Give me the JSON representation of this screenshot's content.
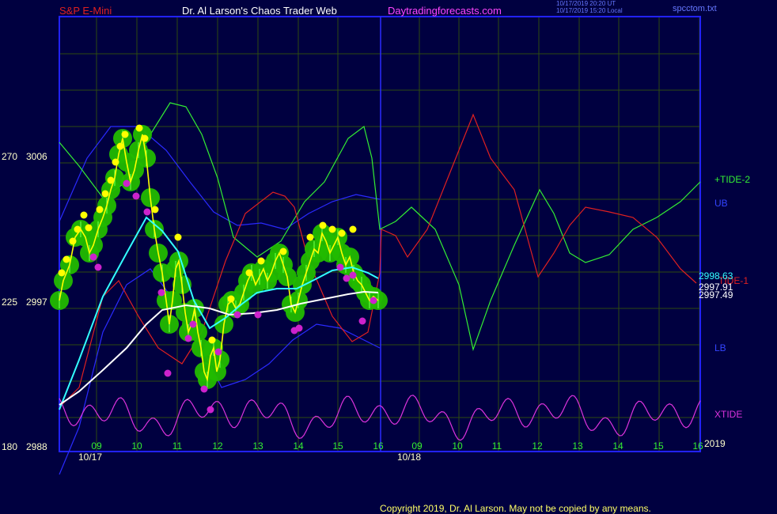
{
  "header": {
    "instrument": "S&P E-Mini",
    "title": "Dr. Al Larson's Chaos Trader Web",
    "website": "Daytradingforecasts.com",
    "time_ut": "10/17/2019 20:20 UT",
    "time_local": "10/17/2019 15:20 Local",
    "file": "spcctom.txt"
  },
  "colors": {
    "background": "#000040",
    "frame": "#2222ff",
    "grid": "#2e4a10",
    "price": "#ffff00",
    "ma_fast": "#33ffff",
    "ma_slow": "#ffffff",
    "tide1": "#e02020",
    "tide2": "#33ee33",
    "bands": "#2a2aff",
    "xtide": "#dd33dd",
    "highs": "#ffff00",
    "lows": "#cc22cc",
    "glow": "#22cc00"
  },
  "y_axis": {
    "labels": [
      {
        "left": "270",
        "right": "3006",
        "value": 3006
      },
      {
        "left": "225",
        "right": "2997",
        "value": 2997
      },
      {
        "left": "180",
        "right": "2988",
        "value": 2988
      }
    ]
  },
  "x_axis": {
    "hour_labels": [
      "09",
      "10",
      "11",
      "12",
      "13",
      "14",
      "15",
      "16",
      "09",
      "10",
      "11",
      "12",
      "13",
      "14",
      "15",
      "16"
    ],
    "date_labels": [
      "10/17",
      "10/18"
    ],
    "year": "2019"
  },
  "right_labels": {
    "tide2": "+TIDE-2",
    "ub": "UB",
    "lb": "LB",
    "xtide": "XTIDE",
    "tide1": "TIDE-1",
    "values": [
      "2998.63",
      "2997.91",
      "2997.49"
    ]
  },
  "footer": {
    "copyright": "Copyright 2019, Dr. Al Larson. May not be copied by any means."
  },
  "chart_data": {
    "type": "line",
    "title": "S&P E-Mini",
    "xlabel": "",
    "ylabel": "",
    "ylim": [
      2988,
      3006
    ],
    "x_range_hours": [
      8,
      16,
      "10/17",
      "10/18"
    ],
    "y_ticks": [
      2988,
      2997,
      3006
    ],
    "grid": true,
    "series": [
      {
        "name": "price",
        "x": [
          8.0,
          8.4,
          8.8,
          9.2,
          9.6,
          10.0,
          10.2,
          10.6,
          10.8,
          11.0,
          11.4,
          11.6,
          11.8,
          12.0,
          12.4,
          12.8,
          13.2,
          13.6,
          14.0,
          14.4,
          14.8,
          15.0,
          15.4,
          15.8
        ],
        "y": [
          2998,
          2999.5,
          3000.5,
          3001,
          3002.5,
          3004.5,
          3006.5,
          3003,
          3000.5,
          2997,
          2999,
          2996,
          2994,
          2993,
          2996.5,
          2998.5,
          2999,
          2999.5,
          2998.5,
          2999.5,
          3001,
          3000.5,
          3001,
          2998
        ]
      },
      {
        "name": "TIDE-1",
        "values": [],
        "note": ""
      },
      {
        "name": "+TIDE-2",
        "values": []
      },
      {
        "name": "XTIDE",
        "values": []
      }
    ],
    "last_values": [
      2998.63,
      2997.91,
      2997.49
    ]
  }
}
